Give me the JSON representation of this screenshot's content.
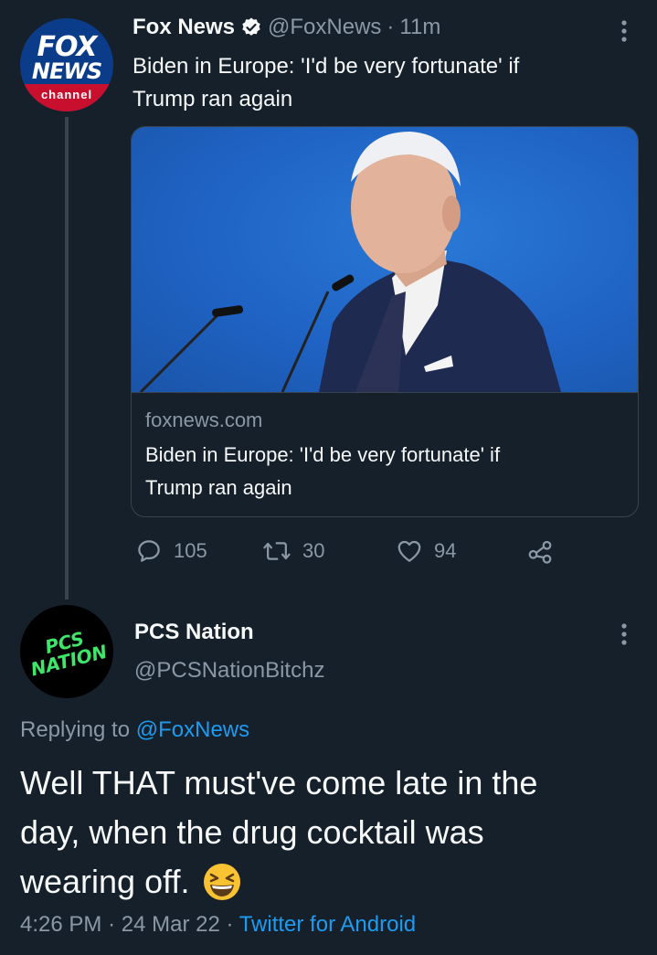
{
  "original_tweet": {
    "author_name": "Fox News",
    "handle": "@FoxNews",
    "separator": "·",
    "time_ago": "11m",
    "text_line1": "Biden in Europe: 'I'd be very fortunate' if",
    "text_line2": "Trump ran again",
    "avatar": {
      "logo_top": "FOX",
      "logo_bottom": "NEWS",
      "logo_band": "channel"
    },
    "card": {
      "domain": "foxnews.com",
      "title_line1": "Biden in Europe: 'I'd be very fortunate' if",
      "title_line2": "Trump ran again"
    },
    "actions": {
      "replies": "105",
      "retweets": "30",
      "likes": "94"
    }
  },
  "reply_tweet": {
    "author_name": "PCS Nation",
    "handle": "@PCSNationBitchz",
    "avatar": {
      "logo_line1": "PCS",
      "logo_line2": "NATION"
    },
    "replying_to_label": "Replying to",
    "replying_to_handle": "@FoxNews",
    "text_line1": "Well THAT must've come late in the",
    "text_line2": "day, when the drug cocktail was",
    "text_line3": "wearing off.",
    "emoji": "😆",
    "time": "4:26 PM",
    "date": "24 Mar 22",
    "source": "Twitter for Android",
    "separator": "·"
  },
  "colors": {
    "background": "#15202b",
    "text": "#f7f9f9",
    "muted": "#8b98a5",
    "link": "#1d9bf0",
    "border": "#38444d",
    "fox_blue": "#0b3c8a",
    "fox_red": "#c8102e",
    "pcs_green": "#3ee66a"
  },
  "icons": {
    "verified": "verified-badge-icon",
    "more": "more-vertical-icon",
    "reply": "reply-icon",
    "retweet": "retweet-icon",
    "like": "heart-icon",
    "share": "share-icon"
  }
}
